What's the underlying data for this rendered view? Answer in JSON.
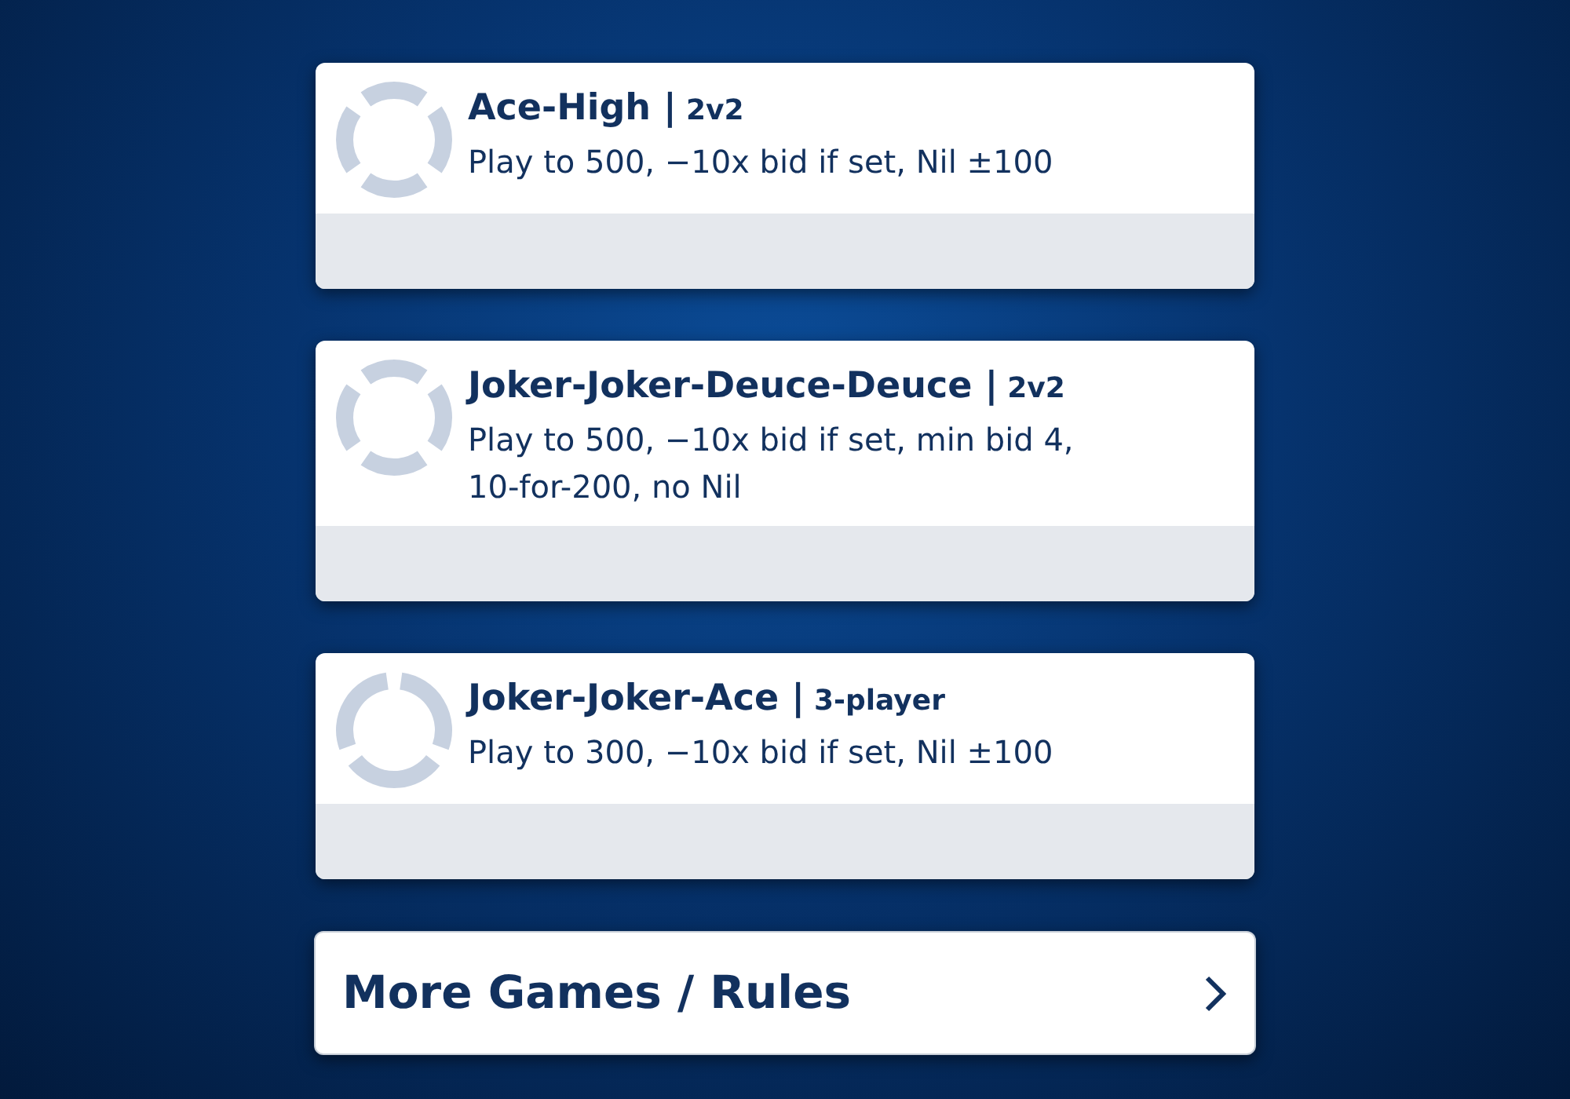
{
  "games": [
    {
      "title": "Ace-High |",
      "mode": "2v2",
      "kind": "pairs",
      "description": "Play to 500, −10x bid if set, Nil ±100"
    },
    {
      "title": "Joker-Joker-Deuce-Deuce |",
      "mode": "2v2",
      "kind": "pairs",
      "description": "Play to 500, −10x bid if set, min bid 4, 10-for-200, no Nil"
    },
    {
      "title": "Joker-Joker-Ace |",
      "mode": "3-player",
      "kind": "three",
      "description": "Play to 300, −10x bid if set, Nil ±100"
    }
  ],
  "more_button": {
    "label": "More Games / Rules"
  }
}
